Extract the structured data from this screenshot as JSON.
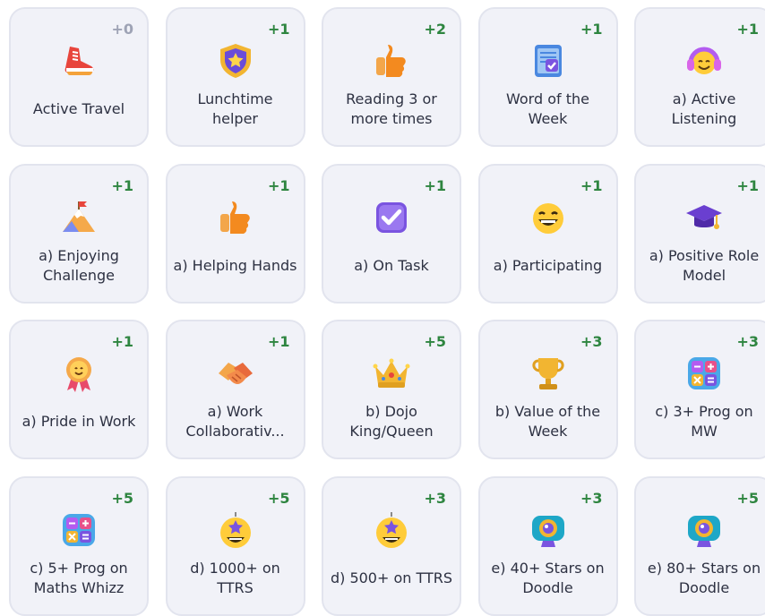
{
  "skills": [
    {
      "points": "+0",
      "label": "Active Travel",
      "icon": "sneaker-icon"
    },
    {
      "points": "+1",
      "label": "Lunchtime helper",
      "icon": "shield-star-icon"
    },
    {
      "points": "+2",
      "label": "Reading 3 or more times",
      "icon": "thumbs-up-icon"
    },
    {
      "points": "+1",
      "label": "Word of the Week",
      "icon": "notepad-check-icon"
    },
    {
      "points": "+1",
      "label": "a) Active Listening",
      "icon": "headphones-face-icon"
    },
    {
      "points": "+1",
      "label": "a) Enjoying Challenge",
      "icon": "mountain-flag-icon"
    },
    {
      "points": "+1",
      "label": "a) Helping Hands",
      "icon": "thumbs-up-icon"
    },
    {
      "points": "+1",
      "label": "a) On Task",
      "icon": "checkbox-icon"
    },
    {
      "points": "+1",
      "label": "a) Participating",
      "icon": "laughing-face-icon"
    },
    {
      "points": "+1",
      "label": "a) Positive Role Model",
      "icon": "graduation-cap-icon"
    },
    {
      "points": "+1",
      "label": "a) Pride in Work",
      "icon": "award-rosette-icon"
    },
    {
      "points": "+1",
      "label": "a) Work Collaborativ...",
      "icon": "handshake-icon"
    },
    {
      "points": "+5",
      "label": "b) Dojo King/Queen",
      "icon": "crown-icon"
    },
    {
      "points": "+3",
      "label": "b) Value of the Week",
      "icon": "trophy-icon"
    },
    {
      "points": "+3",
      "label": "c) 3+ Prog on MW",
      "icon": "calculator-icon"
    },
    {
      "points": "+5",
      "label": "c) 5+ Prog on Maths Whizz",
      "icon": "calculator-icon"
    },
    {
      "points": "+5",
      "label": "d) 1000+ on TTRS",
      "icon": "star-face-icon"
    },
    {
      "points": "+3",
      "label": "d) 500+ on TTRS",
      "icon": "star-face-icon"
    },
    {
      "points": "+3",
      "label": "e) 40+ Stars on Doodle",
      "icon": "camera-icon"
    },
    {
      "points": "+5",
      "label": "e) 80+ Stars on Doodle",
      "icon": "camera-icon"
    }
  ],
  "colors": {
    "card_bg": "#f1f2f8",
    "card_border": "#e2e4ee",
    "points_positive": "#2e8540",
    "points_zero": "#9ea3b5",
    "text": "#2d3142"
  }
}
